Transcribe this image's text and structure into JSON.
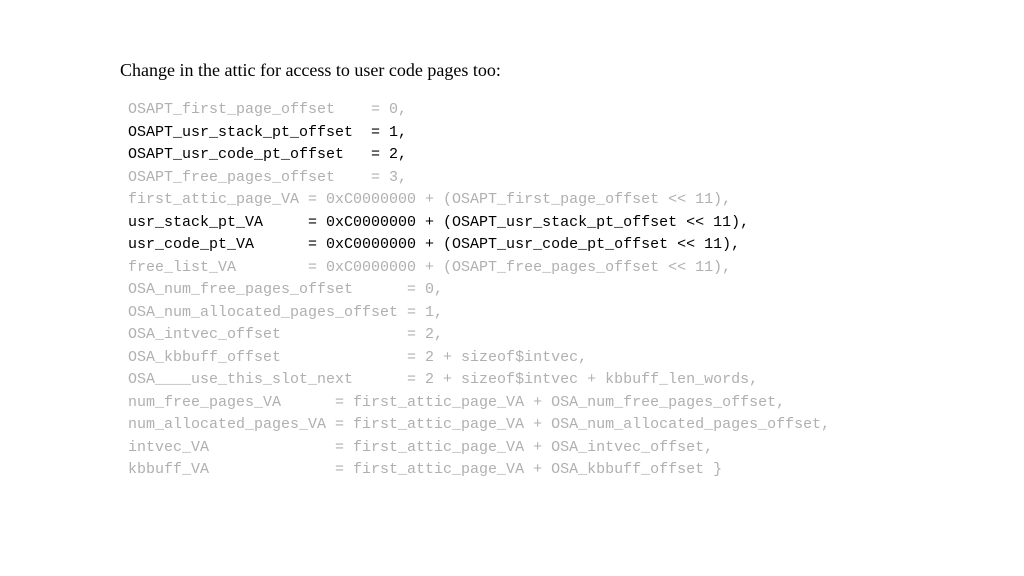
{
  "heading": "Change in the attic for access to user code pages too:",
  "code_lines": [
    {
      "style": "gray",
      "text": "OSAPT_first_page_offset    = 0,"
    },
    {
      "style": "black",
      "text": "OSAPT_usr_stack_pt_offset  = 1,"
    },
    {
      "style": "black",
      "text": "OSAPT_usr_code_pt_offset   = 2,"
    },
    {
      "style": "gray",
      "text": "OSAPT_free_pages_offset    = 3,"
    },
    {
      "style": "gray",
      "text": "first_attic_page_VA = 0xC0000000 + (OSAPT_first_page_offset << 11),"
    },
    {
      "style": "black",
      "text": "usr_stack_pt_VA     = 0xC0000000 + (OSAPT_usr_stack_pt_offset << 11),"
    },
    {
      "style": "black",
      "text": "usr_code_pt_VA      = 0xC0000000 + (OSAPT_usr_code_pt_offset << 11),"
    },
    {
      "style": "gray",
      "text": "free_list_VA        = 0xC0000000 + (OSAPT_free_pages_offset << 11),"
    },
    {
      "style": "gray",
      "text": "OSA_num_free_pages_offset      = 0,"
    },
    {
      "style": "gray",
      "text": "OSA_num_allocated_pages_offset = 1,"
    },
    {
      "style": "gray",
      "text": "OSA_intvec_offset              = 2,"
    },
    {
      "style": "gray",
      "text": "OSA_kbbuff_offset              = 2 + sizeof$intvec,"
    },
    {
      "style": "gray",
      "text": "OSA____use_this_slot_next      = 2 + sizeof$intvec + kbbuff_len_words,"
    },
    {
      "style": "gray",
      "text": "num_free_pages_VA      = first_attic_page_VA + OSA_num_free_pages_offset,"
    },
    {
      "style": "gray",
      "text": "num_allocated_pages_VA = first_attic_page_VA + OSA_num_allocated_pages_offset,"
    },
    {
      "style": "gray",
      "text": "intvec_VA              = first_attic_page_VA + OSA_intvec_offset,"
    },
    {
      "style": "gray",
      "text": "kbbuff_VA              = first_attic_page_VA + OSA_kbbuff_offset }"
    }
  ]
}
